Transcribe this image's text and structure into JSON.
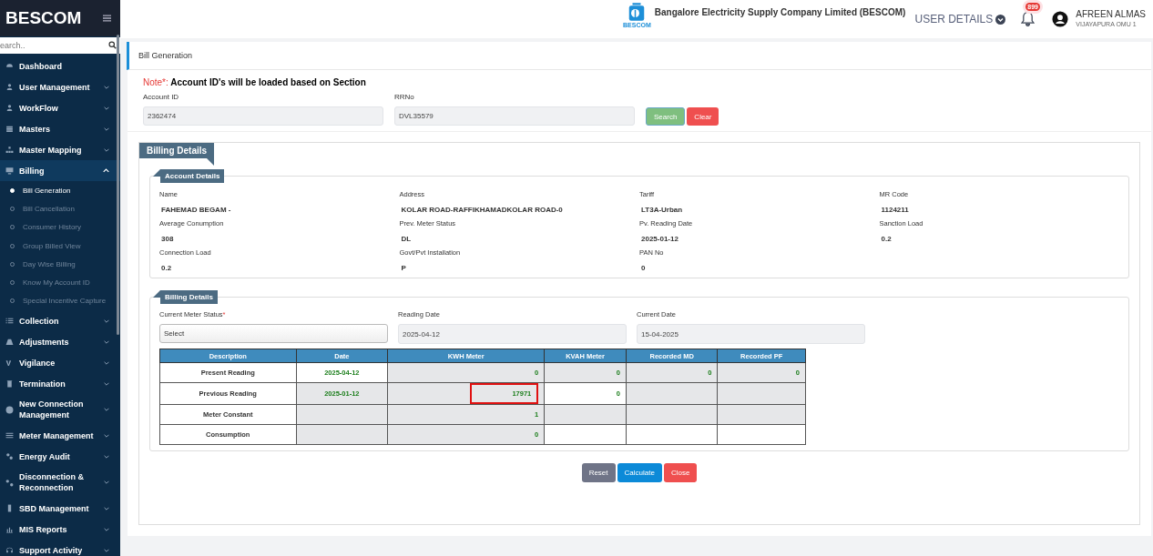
{
  "brand": "BESCOM",
  "sidebar": {
    "search_placeholder": "earch..",
    "items": [
      {
        "label": "Dashboard",
        "expandable": false,
        "selected": false
      },
      {
        "label": "User Management",
        "expandable": true,
        "expanded": false,
        "selected": false
      },
      {
        "label": "WorkFlow",
        "expandable": true,
        "expanded": false,
        "selected": false
      },
      {
        "label": "Masters",
        "expandable": true,
        "expanded": false,
        "selected": false
      },
      {
        "label": "Master Mapping",
        "expandable": true,
        "expanded": false,
        "selected": false
      },
      {
        "label": "Billing",
        "expandable": true,
        "expanded": true,
        "selected": true,
        "children": [
          {
            "label": "Bill Generation",
            "selected": true
          },
          {
            "label": "Bill Cancellation",
            "selected": false
          },
          {
            "label": "Consumer History",
            "selected": false
          },
          {
            "label": "Group Billed View",
            "selected": false
          },
          {
            "label": "Day Wise Billing",
            "selected": false
          },
          {
            "label": "Know My Account ID",
            "selected": false
          },
          {
            "label": "Special Incentive Capture",
            "selected": false
          }
        ]
      },
      {
        "label": "Collection",
        "expandable": true,
        "expanded": false,
        "selected": false
      },
      {
        "label": "Adjustments",
        "expandable": true,
        "expanded": false,
        "selected": false
      },
      {
        "label": "Vigilance",
        "expandable": true,
        "expanded": false,
        "selected": false
      },
      {
        "label": "Termination",
        "expandable": true,
        "expanded": false,
        "selected": false
      },
      {
        "label": "New Connection Management",
        "expandable": true,
        "expanded": false,
        "selected": false
      },
      {
        "label": "Meter Management",
        "expandable": true,
        "expanded": false,
        "selected": false
      },
      {
        "label": "Energy Audit",
        "expandable": true,
        "expanded": false,
        "selected": false
      },
      {
        "label": "Disconnection & Reconnection",
        "expandable": true,
        "expanded": false,
        "selected": false
      },
      {
        "label": "SBD Management",
        "expandable": true,
        "expanded": false,
        "selected": false
      },
      {
        "label": "MIS Reports",
        "expandable": true,
        "expanded": false,
        "selected": false
      },
      {
        "label": "Support Activity",
        "expandable": true,
        "expanded": false,
        "selected": false
      }
    ]
  },
  "header": {
    "company": "Bangalore Electricity Supply Company Limited (BESCOM)",
    "logo_caption": "BESCOM",
    "user_details": "USER DETAILS",
    "notification_count": "899",
    "user_name": "AFREEN ALMAS",
    "user_office": "VIJAYAPURA OMU 1"
  },
  "page_title": "Bill Generation",
  "note": {
    "prefix": "Note*:",
    "text": "Account ID's will be loaded based on Section"
  },
  "search_form": {
    "fields": [
      {
        "label": "Account ID",
        "value": "2362474"
      },
      {
        "label": "RRNo",
        "value": "DVL35579"
      }
    ],
    "buttons": [
      "Search",
      "Clear"
    ]
  },
  "billing_section": {
    "title": "Billing Details",
    "account_details": {
      "title": "Account Details",
      "fields": [
        {
          "label": "Name",
          "value": "FAHEMAD BEGAM -"
        },
        {
          "label": "Address",
          "value": "KOLAR  ROAD-RAFFIKHAMADKOLAR  ROAD-0"
        },
        {
          "label": "Tariff",
          "value": "LT3A-Urban"
        },
        {
          "label": "MR Code",
          "value": "1124211"
        },
        {
          "label": "Average Conumption",
          "value": "308"
        },
        {
          "label": "Prev. Meter Status",
          "value": "DL"
        },
        {
          "label": "Pv. Reading Date",
          "value": "2025-01-12"
        },
        {
          "label": "Sanction Load",
          "value": "0.2"
        },
        {
          "label": "Connection Load",
          "value": "0.2"
        },
        {
          "label": "Govt/Pvt Installation",
          "value": "P"
        },
        {
          "label": "PAN No",
          "value": "0"
        }
      ]
    },
    "billing_details": {
      "title": "Billing Details",
      "fields": [
        {
          "label": "Current Meter Status",
          "required_mark": "*",
          "kind": "select",
          "value": "Select"
        },
        {
          "label": "Reading Date",
          "kind": "text",
          "value": "2025-04-12"
        },
        {
          "label": "Current Date",
          "kind": "text",
          "value": "15-04-2025"
        }
      ],
      "table": {
        "columns": [
          "Description",
          "Date",
          "KWH Meter",
          "KVAH Meter",
          "Recorded MD",
          "Recorded PF"
        ],
        "rows": [
          {
            "cells": [
              {
                "text": "Present Reading",
                "filled": false
              },
              {
                "text": "2025-04-12",
                "filled": false
              },
              {
                "text": "0",
                "filled": true
              },
              {
                "text": "0",
                "filled": true
              },
              {
                "text": "0",
                "filled": true
              },
              {
                "text": "0",
                "filled": true
              }
            ]
          },
          {
            "cells": [
              {
                "text": "Previous Reading",
                "filled": false
              },
              {
                "text": "2025-01-12",
                "filled": true
              },
              {
                "text": "17971",
                "filled": true,
                "highlighted": true
              },
              {
                "text": "0",
                "filled": false
              },
              {
                "text": "",
                "filled": true
              },
              {
                "text": "",
                "filled": true
              }
            ]
          },
          {
            "cells": [
              {
                "text": "Meter Constant",
                "filled": false
              },
              {
                "text": "",
                "filled": true
              },
              {
                "text": "1",
                "filled": true
              },
              {
                "text": "",
                "filled": true
              },
              {
                "text": "",
                "filled": true
              },
              {
                "text": "",
                "filled": true
              }
            ]
          },
          {
            "cells": [
              {
                "text": "Consumption",
                "filled": false
              },
              {
                "text": "",
                "filled": true
              },
              {
                "text": "0",
                "filled": true
              },
              {
                "text": "",
                "filled": false
              },
              {
                "text": "",
                "filled": false
              },
              {
                "text": "",
                "filled": false
              }
            ]
          }
        ]
      }
    },
    "buttons": [
      "Reset",
      "Calculate",
      "Close"
    ]
  }
}
